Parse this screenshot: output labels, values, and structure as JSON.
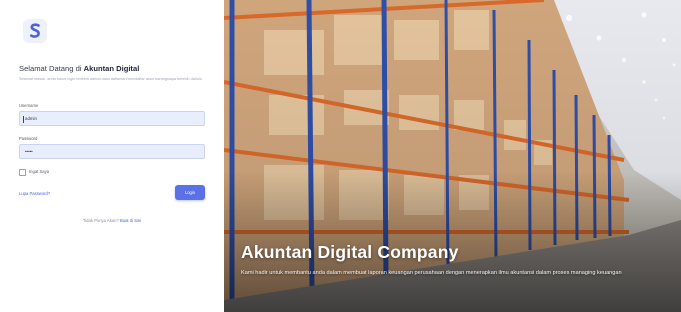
{
  "brand": {
    "logo_letter": "S",
    "logo_color": "#4b63d9",
    "icon": "logo-icon"
  },
  "login": {
    "welcome_prefix": "Selamat Datang di",
    "welcome_brand": "Akuntan Digital",
    "intro": "Selamat masuk, anda harus login terlebih dahulu atau daftarkan/mendaftar akun barangsiapa terlebih dahulu",
    "username_label": "Username",
    "username_value": "admin",
    "password_label": "Password",
    "password_value": "•••••",
    "remember_label": "Ingat Saya",
    "forgot_label": "Lupa Password?",
    "login_label": "Login",
    "signup_prefix": "Tidak Punya Akun?",
    "signup_link": "Buat di Sini"
  },
  "hero": {
    "title": "Akuntan Digital Company",
    "description": "Kami hadir untuk membantu anda dalam membuat laporan keuangan perusahaan dengan menerapkan ilmu akuntansi dalam proses managing keuangan"
  },
  "colors": {
    "accent": "#5b72e6",
    "input_bg": "#e8eefc",
    "rack_blue": "#2f4fa8",
    "rack_orange": "#d8692a"
  }
}
